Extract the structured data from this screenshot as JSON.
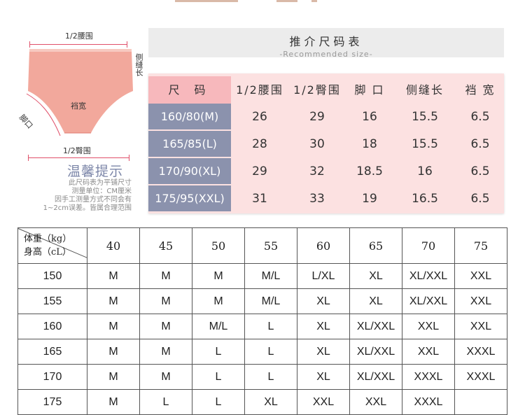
{
  "diagram": {
    "waist_label": "1/2腰围",
    "side_seam_label": "侧缝长",
    "crotch_label": "裆宽",
    "leg_label": "脚口",
    "hip_label": "1/2臀围",
    "colors": {
      "garment": "#f2a89c",
      "accent": "#e0506a"
    }
  },
  "tips": {
    "title": "温馨提示",
    "lines": [
      "此尺码表为平铺尺寸",
      "测量单位：CM厘米",
      "因手工测量方式不同会有",
      "1~2cm误差。皆属合理范围"
    ]
  },
  "recommended": {
    "title": "推介尺码表",
    "subtitle": "-Recommended size-",
    "headers": [
      "尺 码",
      "1/2腰围",
      "1/2臀围",
      "脚 口",
      "侧缝长",
      "裆 宽"
    ],
    "rows": [
      {
        "size": "160/80(M)",
        "values": [
          "26",
          "29",
          "16",
          "15.5",
          "6.5"
        ]
      },
      {
        "size": "165/85(L)",
        "values": [
          "28",
          "30",
          "18",
          "15.5",
          "6.5"
        ]
      },
      {
        "size": "170/90(XL)",
        "values": [
          "29",
          "32",
          "18.5",
          "16",
          "6.5"
        ]
      },
      {
        "size": "175/95(XXL)",
        "values": [
          "31",
          "33",
          "19",
          "16.5",
          "6.5"
        ]
      }
    ],
    "colors": {
      "header_bg": "#ececec",
      "table_bg": "#fce1e1",
      "size_bg": "#8b92ad",
      "head_first_bg": "#f7b8bc"
    }
  },
  "weight_height": {
    "corner_weight": "体重（kg）",
    "corner_height": "身高（cL）",
    "weights": [
      "40",
      "45",
      "50",
      "55",
      "60",
      "65",
      "70",
      "75"
    ],
    "rows": [
      {
        "height": "150",
        "sizes": [
          "M",
          "M",
          "M",
          "M/L",
          "L/XL",
          "XL",
          "XL/XXL",
          "XXL"
        ]
      },
      {
        "height": "155",
        "sizes": [
          "M",
          "M",
          "M",
          "M/L",
          "XL",
          "XL",
          "XL/XXL",
          "XXL"
        ]
      },
      {
        "height": "160",
        "sizes": [
          "M",
          "M",
          "M/L",
          "L",
          "XL",
          "XL/XXL",
          "XXL",
          "XXL"
        ]
      },
      {
        "height": "165",
        "sizes": [
          "M",
          "M",
          "L",
          "L",
          "XL",
          "XL/XXL",
          "XXL",
          "XXXL"
        ]
      },
      {
        "height": "170",
        "sizes": [
          "M",
          "M",
          "L",
          "L",
          "XL",
          "XL/XXL",
          "XXXL",
          "XXXL"
        ]
      },
      {
        "height": "175",
        "sizes": [
          "M",
          "L",
          "L",
          "XL",
          "XXL",
          "XXL",
          "XXXL",
          ""
        ]
      }
    ]
  }
}
